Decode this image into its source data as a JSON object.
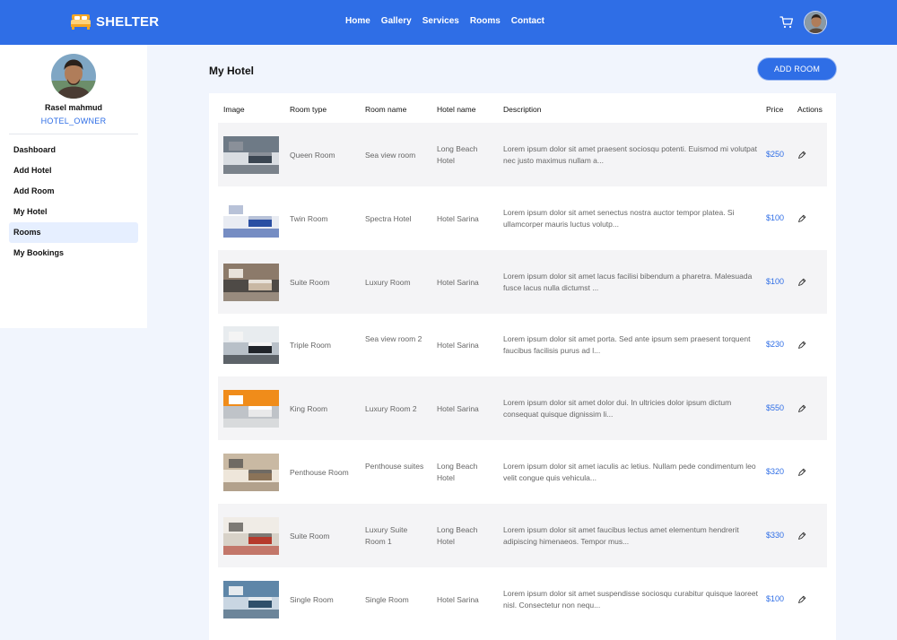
{
  "brand": {
    "name": "SHELTER"
  },
  "nav": [
    "Home",
    "Gallery",
    "Services",
    "Rooms",
    "Contact"
  ],
  "user": {
    "name": "Rasel mahmud",
    "role": "HOTEL_OWNER"
  },
  "sidebar": {
    "items": [
      "Dashboard",
      "Add Hotel",
      "Add Room",
      "My Hotel",
      "Rooms",
      "My Bookings"
    ],
    "active": "Rooms"
  },
  "main": {
    "title": "My Hotel",
    "add_button": "ADD ROOM"
  },
  "table": {
    "columns": [
      "Image",
      "Room type",
      "Room name",
      "Hotel name",
      "Description",
      "Price",
      "Actions"
    ],
    "rows": [
      {
        "type": "Queen Room",
        "name": "Sea view room",
        "hotel": "Long Beach Hotel",
        "description": "Lorem ipsum dolor sit amet praesent sociosqu potenti. Euismod mi volutpat nec justo maximus nullam a...",
        "price": "$250"
      },
      {
        "type": "Twin Room",
        "name": "Spectra Hotel",
        "hotel": "Hotel Sarina",
        "description": "Lorem ipsum dolor sit amet senectus nostra auctor tempor platea. Si ullamcorper mauris luctus volutp...",
        "price": "$100"
      },
      {
        "type": "Suite Room",
        "name": "Luxury Room",
        "hotel": "Hotel Sarina",
        "description": "Lorem ipsum dolor sit amet lacus facilisi bibendum a pharetra. Malesuada fusce lacus nulla dictumst ...",
        "price": "$100"
      },
      {
        "type": "Triple Room",
        "name": "Sea view room 2",
        "hotel": "Hotel Sarina",
        "description": "Lorem ipsum dolor sit amet porta. Sed ante ipsum sem praesent torquent faucibus facilisis purus ad l...",
        "price": "$230"
      },
      {
        "type": "King Room",
        "name": "Luxury Room 2",
        "hotel": "Hotel Sarina",
        "description": "Lorem ipsum dolor sit amet dolor dui. In ultricies dolor ipsum dictum consequat quisque dignissim li...",
        "price": "$550"
      },
      {
        "type": "Penthouse Room",
        "name": "Penthouse suites",
        "hotel": "Long Beach Hotel",
        "description": "Lorem ipsum dolor sit amet iaculis ac letius. Nullam pede condimentum leo velit congue quis vehicula...",
        "price": "$320"
      },
      {
        "type": "Suite Room",
        "name": "Luxury Suite Room 1",
        "hotel": "Long Beach Hotel",
        "description": "Lorem ipsum dolor sit amet faucibus lectus amet elementum hendrerit adipiscing himenaeos. Tempor mus...",
        "price": "$330"
      },
      {
        "type": "Single Room",
        "name": "Single Room",
        "hotel": "Hotel Sarina",
        "description": "Lorem ipsum dolor sit amet suspendisse sociosqu curabitur quisque laoreet nisl. Consectetur non nequ...",
        "price": "$100"
      }
    ]
  },
  "icons": {
    "cart": "cart-icon",
    "edit": "edit-icon",
    "logo": "bed-logo-icon"
  },
  "colors": {
    "primary": "#2f6ee6",
    "background": "#f1f5fd",
    "row_shade": "#f4f4f6"
  }
}
